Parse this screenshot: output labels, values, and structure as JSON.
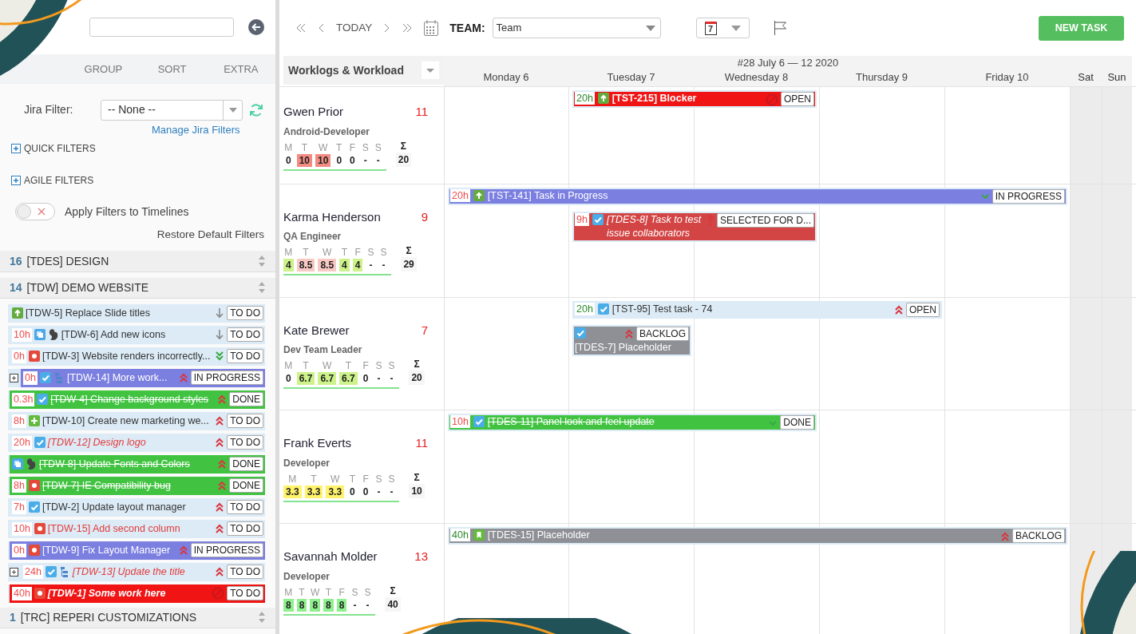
{
  "tabs": [
    {
      "label": "GROUP",
      "selected": false
    },
    {
      "label": "SORT",
      "selected": false
    },
    {
      "label": "EXTRA",
      "selected": false
    }
  ],
  "jira_filter": {
    "label": "Jira Filter:",
    "value": "-- None --",
    "link": "Manage Jira Filters"
  },
  "filter_sections": [
    {
      "label": "QUICK FILTERS",
      "expanded": false
    },
    {
      "label": "AGILE FILTERS",
      "expanded": false
    }
  ],
  "apply_toggle": {
    "label": "Apply Filters to Timelines",
    "on": false
  },
  "restore_link": "Restore Default Filters",
  "groups": [
    {
      "count": "16",
      "title": "[TDES] DESIGN"
    },
    {
      "count": "14",
      "title": "[TDW] DEMO WEBSITE",
      "tasks": [
        {
          "expandable": false,
          "icons": [
            {
              "kind": "story"
            }
          ],
          "title": "[TDW-5] Replace Slide titles",
          "done": false,
          "italic": false,
          "bold": false,
          "overdue": false,
          "priority": {
            "kind": "low"
          },
          "status": "TO DO",
          "color": "#dcebf6"
        },
        {
          "expandable": false,
          "hours": "10h",
          "overrun": true,
          "icons": [
            {
              "kind": "improvement"
            },
            {
              "kind": "creature"
            }
          ],
          "title": "[TDW-6] Add new icons",
          "done": false,
          "italic": false,
          "bold": false,
          "overdue": false,
          "priority": {
            "kind": "low"
          },
          "status": "TO DO",
          "color": "#dcebf6"
        },
        {
          "expandable": false,
          "hours": "0h",
          "overrun": true,
          "icons": [
            {
              "kind": "bug"
            }
          ],
          "title": "[TDW-3] Website renders incorrectly...",
          "done": false,
          "italic": false,
          "bold": false,
          "overdue": false,
          "priority": {
            "kind": "lowest"
          },
          "status": "TO DO",
          "color": "#dcebf6"
        },
        {
          "expandable": true,
          "hours": "0h",
          "overrun": true,
          "icons": [
            {
              "kind": "task"
            },
            {
              "kind": "tree"
            }
          ],
          "title": "[TDW-14] More work...",
          "done": false,
          "italic": false,
          "bold": false,
          "overdue": false,
          "priority": {
            "kind": "highest"
          },
          "status": "IN PROGRESS",
          "color": "#7b7fe0"
        },
        {
          "expandable": false,
          "hours": "0.3h",
          "overrun": true,
          "icons": [
            {
              "kind": "task"
            }
          ],
          "title": "[TDW-4] Change background styles",
          "done": true,
          "italic": false,
          "bold": false,
          "overdue": false,
          "priority": {
            "kind": "highest"
          },
          "status": "DONE",
          "color": "#41c341"
        },
        {
          "expandable": false,
          "hours": "8h",
          "overrun": true,
          "icons": [
            {
              "kind": "feature"
            }
          ],
          "title": "[TDW-10] Create new marketing we...",
          "done": false,
          "italic": false,
          "bold": false,
          "overdue": false,
          "priority": {
            "kind": "highest"
          },
          "status": "TO DO",
          "color": "#dcebf6"
        },
        {
          "expandable": false,
          "hours": "20h",
          "overrun": true,
          "icons": [
            {
              "kind": "task"
            }
          ],
          "title": "[TDW-12] Design logo",
          "done": false,
          "italic": true,
          "bold": false,
          "overdue": true,
          "priority": {
            "kind": "highest"
          },
          "status": "TO DO",
          "color": "#dcebf6"
        },
        {
          "expandable": false,
          "icons": [
            {
              "kind": "improvement"
            },
            {
              "kind": "creature"
            }
          ],
          "title": "[TDW-8] Update Fonts and Colors",
          "done": true,
          "italic": false,
          "bold": false,
          "overdue": false,
          "priority": {
            "kind": "highest"
          },
          "status": "DONE",
          "color": "#41c341"
        },
        {
          "expandable": false,
          "hours": "8h",
          "overrun": true,
          "icons": [
            {
              "kind": "bug"
            }
          ],
          "title": "[TDW-7] IE Compatibility bug",
          "done": true,
          "italic": false,
          "bold": false,
          "overdue": false,
          "priority": {
            "kind": "highest"
          },
          "status": "DONE",
          "color": "#41c341"
        },
        {
          "expandable": false,
          "hours": "7h",
          "overrun": true,
          "icons": [
            {
              "kind": "task"
            }
          ],
          "title": "[TDW-2] Update layout manager",
          "done": false,
          "italic": false,
          "bold": false,
          "overdue": false,
          "priority": {
            "kind": "highest"
          },
          "status": "TO DO",
          "color": "#dcebf6"
        },
        {
          "expandable": false,
          "hours": "10h",
          "overrun": true,
          "icons": [
            {
              "kind": "bug"
            }
          ],
          "title": "[TDW-15] Add second column",
          "done": false,
          "italic": false,
          "bold": false,
          "overdue": true,
          "priority": {
            "kind": "highest"
          },
          "status": "TO DO",
          "color": "#dcebf6"
        },
        {
          "expandable": false,
          "hours": "0h",
          "overrun": true,
          "icons": [
            {
              "kind": "bug"
            }
          ],
          "title": "[TDW-9] Fix Layout Manager",
          "done": false,
          "italic": false,
          "bold": false,
          "overdue": false,
          "priority": {
            "kind": "highest"
          },
          "status": "IN PROGRESS",
          "color": "#7b7fe0"
        },
        {
          "expandable": true,
          "hours": "24h",
          "overrun": true,
          "icons": [
            {
              "kind": "task"
            },
            {
              "kind": "tree"
            }
          ],
          "title": "[TDW-13] Update the title",
          "done": false,
          "italic": true,
          "bold": false,
          "overdue": true,
          "priority": {
            "kind": "highest"
          },
          "status": "TO DO",
          "color": "#dcebf6"
        },
        {
          "expandable": false,
          "hours": "40h",
          "overrun": true,
          "icons": [
            {
              "kind": "bug"
            }
          ],
          "title": "[TDW-1] Some work here",
          "done": false,
          "italic": true,
          "bold": true,
          "overdue": false,
          "priority": {
            "kind": "blocker"
          },
          "status": "TO DO",
          "color": "#f01414"
        }
      ]
    },
    {
      "count": "1",
      "title": "[TRC] REPERI CUSTOMIZATIONS"
    }
  ],
  "toolbar": {
    "today": "TODAY",
    "team_label": "TEAM:",
    "team_value": "Team",
    "date_day": "7",
    "new_task": "NEW TASK"
  },
  "workload_header": "Worklogs & Workload",
  "week_label": "#28 July 6 — 12 2020",
  "days": [
    {
      "label": "Monday 6",
      "weekend": false
    },
    {
      "label": "Tuesday 7",
      "weekend": false
    },
    {
      "label": "Wednesday 8",
      "weekend": false
    },
    {
      "label": "Thursday 9",
      "weekend": false
    },
    {
      "label": "Friday 10",
      "weekend": false
    },
    {
      "label": "Sat",
      "weekend": true
    },
    {
      "label": "Sun",
      "weekend": true
    }
  ],
  "people": [
    {
      "name": "Gwen Prior",
      "count": "11",
      "role": "Android-Developer",
      "day_letters": [
        "M",
        "T",
        "W",
        "T",
        "F",
        "S",
        "S"
      ],
      "sigma": "Σ",
      "total": "20",
      "values": [
        {
          "value": "0"
        },
        {
          "value": "10",
          "color": "#f28b82"
        },
        {
          "value": "10",
          "color": "#f28b82"
        },
        {
          "value": "0"
        },
        {
          "value": "0"
        },
        {
          "value": "-"
        },
        {
          "value": "-"
        }
      ],
      "lanes": [
        [
          {
            "from": {
              "kind": "tue"
            },
            "to": {
              "kind": "wed"
            },
            "hours": "20h",
            "overrun": false,
            "icons": [
              {
                "kind": "story"
              }
            ],
            "title": "[TST-215] Blocker",
            "done": false,
            "italic": false,
            "bold": true,
            "priority": {
              "kind": "blocker"
            },
            "status": "OPEN",
            "color": "#f01414"
          }
        ]
      ]
    },
    {
      "name": "Karma Henderson",
      "count": "9",
      "role": "QA Engineer",
      "day_letters": [
        "M",
        "T",
        "W",
        "T",
        "F",
        "S",
        "S"
      ],
      "sigma": "Σ",
      "total": "29",
      "values": [
        {
          "value": "4",
          "color": "#cdf28a"
        },
        {
          "value": "8.5",
          "color": "#f8c9c4"
        },
        {
          "value": "8.5",
          "color": "#f8c9c4"
        },
        {
          "value": "4",
          "color": "#cdf28a"
        },
        {
          "value": "4",
          "color": "#cdf28a"
        },
        {
          "value": "-"
        },
        {
          "value": "-"
        }
      ],
      "lanes": [
        [
          {
            "from": {
              "kind": "mon"
            },
            "to": {
              "kind": "fri"
            },
            "hours": "20h",
            "overrun": true,
            "icons": [
              {
                "kind": "story"
              }
            ],
            "title": "[TST-141] Task in Progress",
            "done": false,
            "italic": false,
            "bold": false,
            "priority": {
              "kind": "low-chevron"
            },
            "status": "IN PROGRESS",
            "color": "#7b7fe0"
          }
        ],
        [
          {
            "from": {
              "kind": "tue"
            },
            "to": {
              "kind": "wed"
            },
            "hours": "9h",
            "overrun": true,
            "icons": [
              {
                "kind": "task"
              }
            ],
            "title": "[TDES-8] Task to test issue collaborators",
            "done": false,
            "italic": true,
            "bold": false,
            "priority": {
              "kind": "high"
            },
            "status": "SELECTED FOR D...",
            "color": "#d34545"
          }
        ]
      ]
    },
    {
      "name": "Kate Brewer",
      "count": "7",
      "role": "Dev Team Leader",
      "day_letters": [
        "M",
        "T",
        "W",
        "T",
        "F",
        "S",
        "S"
      ],
      "sigma": "Σ",
      "total": "20",
      "values": [
        {
          "value": "0"
        },
        {
          "value": "6.7",
          "color": "#cdf28a"
        },
        {
          "value": "6.7",
          "color": "#cdf28a"
        },
        {
          "value": "6.7",
          "color": "#cdf28a"
        },
        {
          "value": "0"
        },
        {
          "value": "-"
        },
        {
          "value": "-"
        }
      ],
      "lanes": [
        [
          {
            "from": {
              "kind": "tue"
            },
            "to": {
              "kind": "thu"
            },
            "hours": "20h",
            "overrun": false,
            "icons": [
              {
                "kind": "task"
              }
            ],
            "title": "[TST-95] Test task - 74",
            "done": false,
            "italic": false,
            "bold": false,
            "priority": {
              "kind": "highest"
            },
            "status": "OPEN",
            "color": "#dcebf6"
          }
        ],
        [
          {
            "from": {
              "kind": "tue"
            },
            "to": {
              "kind": "tue"
            },
            "icons": [
              {
                "kind": "task"
              }
            ],
            "title": "[TDES-7] Placeholder",
            "done": false,
            "italic": false,
            "bold": false,
            "priority": {
              "kind": "highest"
            },
            "status": "BACKLOG",
            "color": "#8e9096"
          }
        ]
      ]
    },
    {
      "name": "Frank Everts",
      "count": "11",
      "role": "Developer",
      "day_letters": [
        "M",
        "T",
        "W",
        "T",
        "F",
        "S",
        "S"
      ],
      "sigma": "Σ",
      "total": "10",
      "values": [
        {
          "value": "3.3",
          "color": "#fff36b"
        },
        {
          "value": "3.3",
          "color": "#fff36b"
        },
        {
          "value": "3.3",
          "color": "#fff36b"
        },
        {
          "value": "0"
        },
        {
          "value": "0"
        },
        {
          "value": "-"
        },
        {
          "value": "-"
        }
      ],
      "lanes": [
        [
          {
            "from": {
              "kind": "mon"
            },
            "to": {
              "kind": "wed"
            },
            "hours": "10h",
            "overrun": true,
            "icons": [
              {
                "kind": "task"
              }
            ],
            "title": "[TDES-11] Panel look and feel update",
            "done": true,
            "italic": false,
            "bold": false,
            "priority": {
              "kind": "low-chevron"
            },
            "status": "DONE",
            "color": "#41c341"
          }
        ]
      ]
    },
    {
      "name": "Savannah Molder",
      "count": "13",
      "role": "Developer",
      "day_letters": [
        "M",
        "T",
        "W",
        "T",
        "F",
        "S",
        "S"
      ],
      "sigma": "Σ",
      "total": "40",
      "values": [
        {
          "value": "8",
          "color": "#8ef08e"
        },
        {
          "value": "8",
          "color": "#8ef08e"
        },
        {
          "value": "8",
          "color": "#8ef08e"
        },
        {
          "value": "8",
          "color": "#8ef08e"
        },
        {
          "value": "8",
          "color": "#8ef08e"
        },
        {
          "value": "-"
        },
        {
          "value": "-"
        }
      ],
      "lanes": [
        [
          {
            "from": {
              "kind": "mon"
            },
            "to": {
              "kind": "fri"
            },
            "hours": "40h",
            "overrun": false,
            "icons": [
              {
                "kind": "bookmark"
              }
            ],
            "title": "[TDES-15] Placeholder",
            "done": false,
            "italic": false,
            "bold": false,
            "priority": {
              "kind": "highest"
            },
            "status": "BACKLOG",
            "color": "#8e9096"
          }
        ]
      ]
    }
  ]
}
